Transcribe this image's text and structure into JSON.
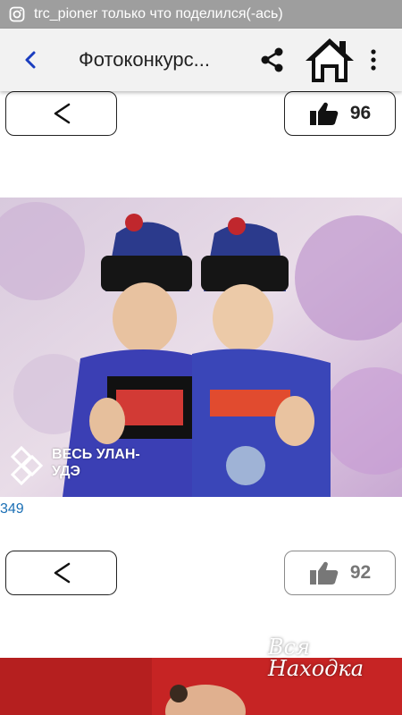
{
  "status_bar": {
    "notification": "trc_pioner только что поделился(-ась)",
    "app_icon": "instagram-icon"
  },
  "app_bar": {
    "back_icon": "back-chevron-icon",
    "title": "Фотоконкурс...",
    "share_icon": "share-icon",
    "home_icon": "home-icon",
    "more_icon": "more-vertical-icon"
  },
  "entries": [
    {
      "likes": "96"
    },
    {
      "likes": "92",
      "vote_count": "349",
      "watermark": "ВЕСЬ УЛАН-УДЭ"
    },
    {
      "watermark": "Вся Находка"
    }
  ],
  "colors": {
    "status_bar": "#9e9e9e",
    "app_bar": "#f2f2f2",
    "accent_blue": "#1a3dbf",
    "link_blue": "#1a6fb5"
  }
}
